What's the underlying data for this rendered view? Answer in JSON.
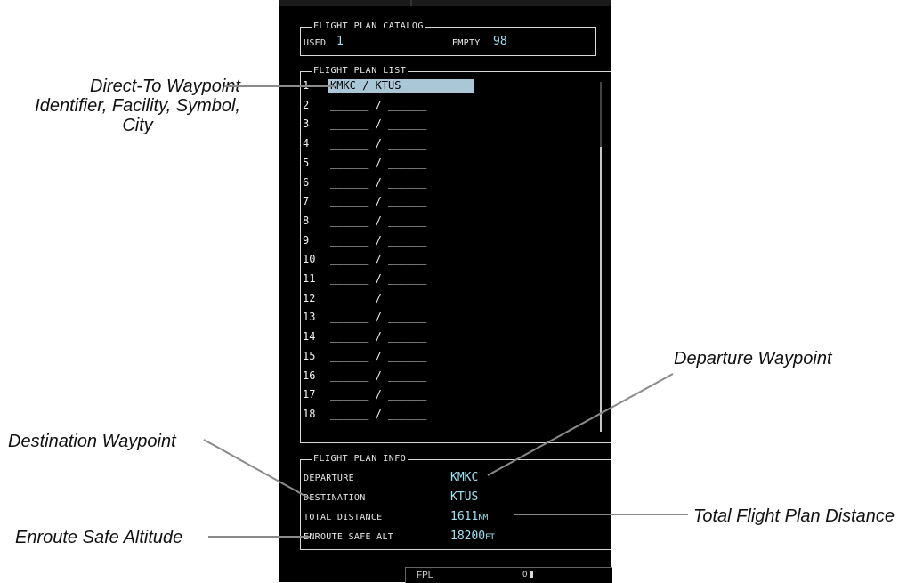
{
  "catalog": {
    "title": "FLIGHT PLAN CATALOG",
    "used_label": "USED",
    "used_value": "1",
    "empty_label": "EMPTY",
    "empty_value": "98"
  },
  "list": {
    "title": "FLIGHT PLAN LIST",
    "rows": [
      {
        "num": "1",
        "plan": "KMKC / KTUS"
      },
      {
        "num": "2",
        "plan": "______ / ______"
      },
      {
        "num": "3",
        "plan": "______ / ______"
      },
      {
        "num": "4",
        "plan": "______ / ______"
      },
      {
        "num": "5",
        "plan": "______ / ______"
      },
      {
        "num": "6",
        "plan": "______ / ______"
      },
      {
        "num": "7",
        "plan": "______ / ______"
      },
      {
        "num": "8",
        "plan": "______ / ______"
      },
      {
        "num": "9",
        "plan": "______ / ______"
      },
      {
        "num": "10",
        "plan": "______ / ______"
      },
      {
        "num": "11",
        "plan": "______ / ______"
      },
      {
        "num": "12",
        "plan": "______ / ______"
      },
      {
        "num": "13",
        "plan": "______ / ______"
      },
      {
        "num": "14",
        "plan": "______ / ______"
      },
      {
        "num": "15",
        "plan": "______ / ______"
      },
      {
        "num": "16",
        "plan": "______ / ______"
      },
      {
        "num": "17",
        "plan": "______ / ______"
      },
      {
        "num": "18",
        "plan": "______ / ______"
      }
    ]
  },
  "info": {
    "title": "FLIGHT PLAN INFO",
    "departure_label": "DEPARTURE",
    "departure_value": "KMKC",
    "destination_label": "DESTINATION",
    "destination_value": "KTUS",
    "distance_label": "TOTAL DISTANCE",
    "distance_value": "1611",
    "distance_unit": "NM",
    "esa_label": "ENROUTE SAFE ALT",
    "esa_value": "18200",
    "esa_unit": "FT"
  },
  "status": {
    "page_label": "FPL",
    "page_indicator": "O"
  },
  "annotations": {
    "direct_to_line1": "Direct-To Waypoint",
    "direct_to_line2": "Identifier, Facility, Symbol,",
    "direct_to_line3": "City",
    "departure": "Departure Waypoint",
    "destination": "Destination Waypoint",
    "esa": "Enroute Safe Altitude",
    "total_distance": "Total Flight Plan Distance"
  },
  "colors": {
    "screen_bg": "#000000",
    "highlight": "#a9c7d6",
    "value_cyan": "#9ce2f0",
    "leader_line": "#8a8a8a"
  }
}
